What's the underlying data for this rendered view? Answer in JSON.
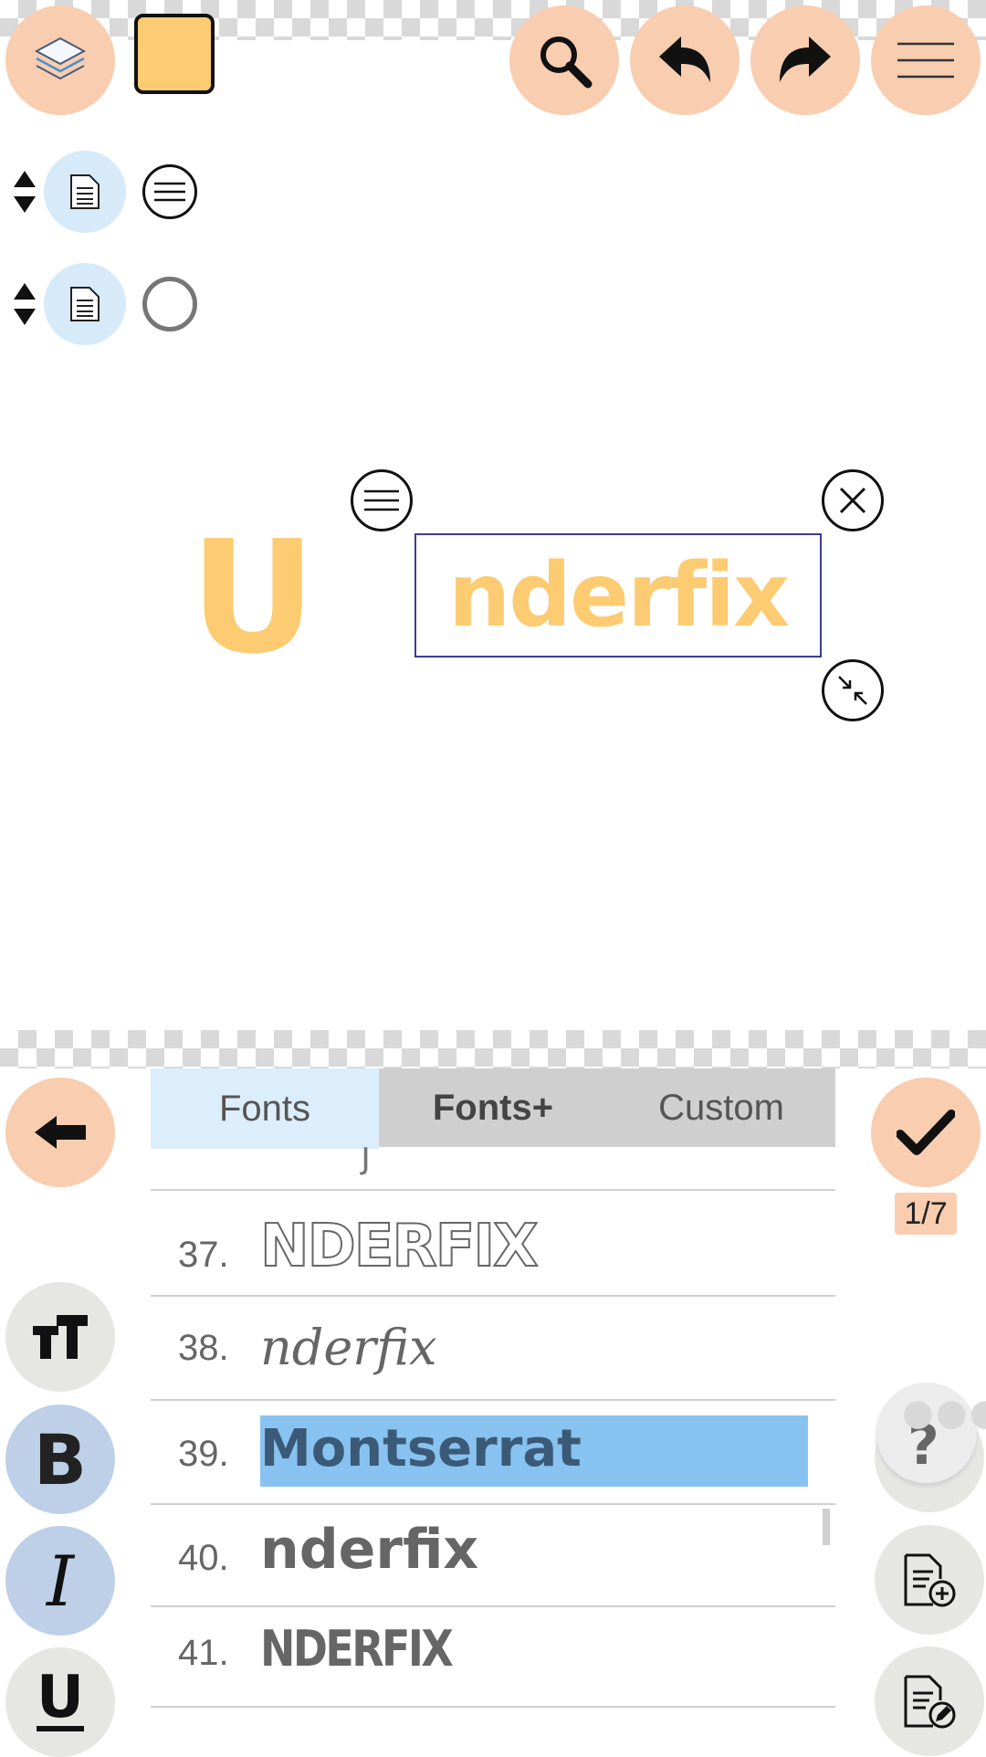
{
  "toolbar": {
    "layers_icon": "layers-icon",
    "color_swatch": "#fdcb72",
    "search_icon": "search-icon",
    "undo_icon": "undo-icon",
    "redo_icon": "redo-icon",
    "menu_icon": "menu-icon"
  },
  "layers": [
    {
      "icon": "document-icon",
      "option_icon": "menu-circle-icon"
    },
    {
      "icon": "document-icon",
      "option_icon": "circle-icon"
    }
  ],
  "canvas": {
    "letter": "U",
    "selected_text": "nderfix",
    "text_color": "#fdcb72"
  },
  "panel": {
    "tabs": [
      {
        "label": "Fonts",
        "active": true
      },
      {
        "label": "Fonts+",
        "active": false
      },
      {
        "label": "Custom",
        "active": false
      }
    ],
    "page_indicator": "1/7",
    "fonts": [
      {
        "number": "37.",
        "sample": "NDERFIX"
      },
      {
        "number": "38.",
        "sample": "nderfix"
      },
      {
        "number": "39.",
        "sample": "Montserrat",
        "selected": true
      },
      {
        "number": "40.",
        "sample": "nderfix"
      },
      {
        "number": "41.",
        "sample": "NDERFIX"
      }
    ],
    "left_buttons": {
      "back_icon": "back-arrow-icon",
      "text_size_icon": "text-size-icon",
      "bold_label": "B",
      "italic_label": "I",
      "underline_label": "U"
    },
    "right_buttons": {
      "confirm_icon": "checkmark-icon",
      "help_label": "?",
      "add_page_icon": "add-document-icon",
      "edit_page_icon": "edit-document-icon"
    }
  },
  "colors": {
    "accent": "#f8cdb0",
    "selection": "#88c2f0",
    "tab_active": "#dcedfb",
    "tab_inactive": "#cfcfcf"
  }
}
